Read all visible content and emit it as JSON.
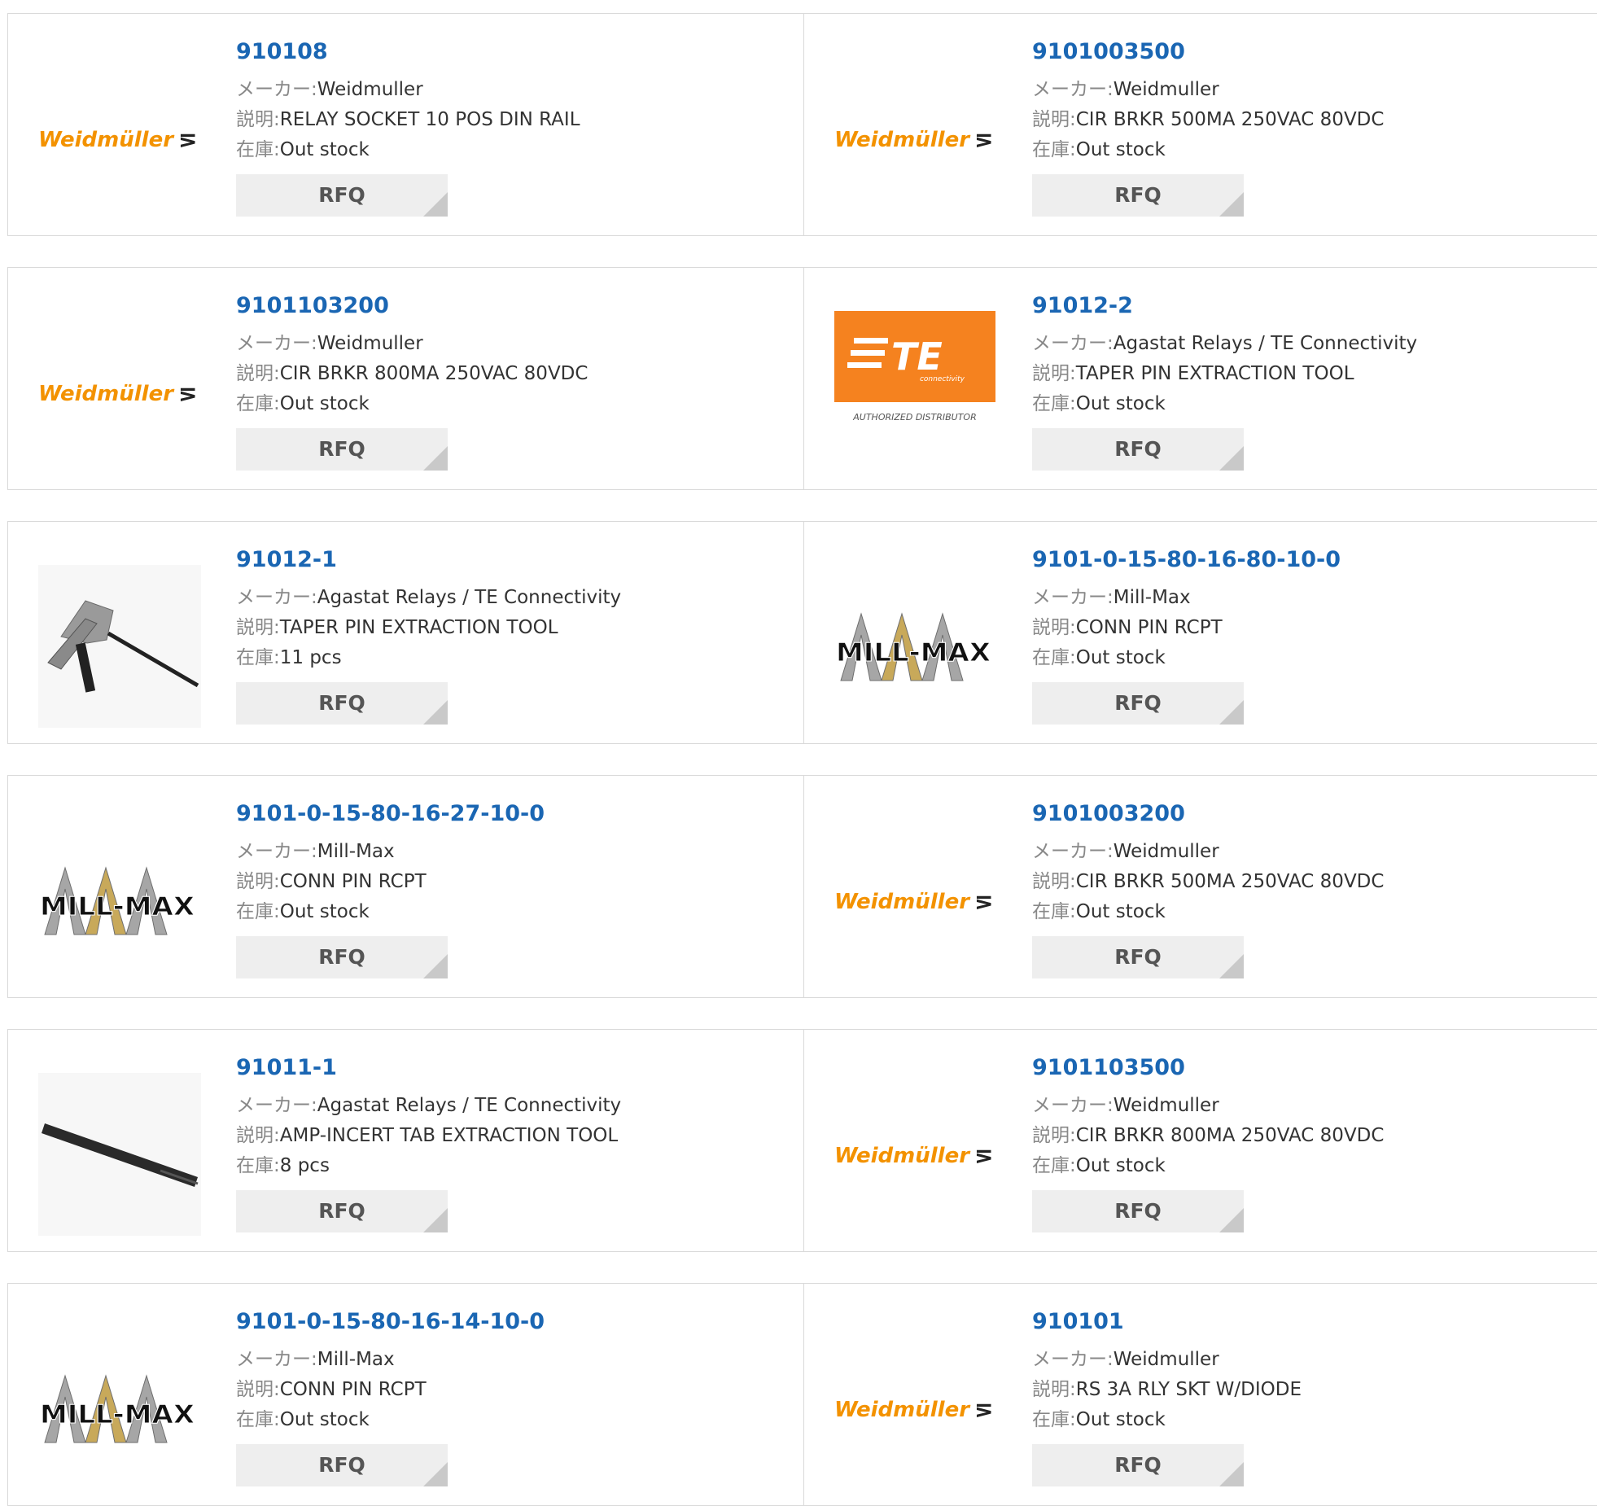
{
  "labels": {
    "maker": "メーカー:",
    "description": "説明:",
    "stock": "在庫:",
    "rfq": "RFQ"
  },
  "logos": {
    "weidmuller": {
      "text": "Weidmüller",
      "symbol": "⋝",
      "color": "#f39200"
    },
    "te": {
      "text": "TE",
      "subtext": "connectivity",
      "caption": "AUTHORIZED DISTRIBUTOR",
      "bg": "#f5821f"
    },
    "millmax": {
      "text": "MILL-MAX"
    }
  },
  "colors": {
    "part_link": "#1a66b3",
    "border": "#d9d9d9",
    "button_bg": "#eeeeee"
  },
  "rows": [
    {
      "left": {
        "part": "910108",
        "maker": "Weidmuller",
        "desc": "RELAY SOCKET 10 POS DIN RAIL",
        "stock": "Out stock",
        "logo": "weidmuller"
      },
      "right": {
        "part": "9101003500",
        "maker": "Weidmuller",
        "desc": "CIR BRKR 500MA 250VAC 80VDC",
        "stock": "Out stock",
        "logo": "weidmuller"
      }
    },
    {
      "left": {
        "part": "9101103200",
        "maker": "Weidmuller",
        "desc": "CIR BRKR 800MA 250VAC 80VDC",
        "stock": "Out stock",
        "logo": "weidmuller"
      },
      "right": {
        "part": "91012-2",
        "maker": "Agastat Relays / TE Connectivity",
        "desc": "TAPER PIN EXTRACTION TOOL",
        "stock": "Out stock",
        "logo": "te"
      }
    },
    {
      "left": {
        "part": "91012-1",
        "maker": "Agastat Relays / TE Connectivity",
        "desc": "TAPER PIN EXTRACTION TOOL",
        "stock": "11 pcs",
        "logo": "tool-gun"
      },
      "right": {
        "part": "9101-0-15-80-16-80-10-0",
        "maker": "Mill-Max",
        "desc": "CONN PIN RCPT",
        "stock": "Out stock",
        "logo": "millmax"
      }
    },
    {
      "left": {
        "part": "9101-0-15-80-16-27-10-0",
        "maker": "Mill-Max",
        "desc": "CONN PIN RCPT",
        "stock": "Out stock",
        "logo": "millmax"
      },
      "right": {
        "part": "9101003200",
        "maker": "Weidmuller",
        "desc": "CIR BRKR 500MA 250VAC 80VDC",
        "stock": "Out stock",
        "logo": "weidmuller"
      }
    },
    {
      "left": {
        "part": "91011-1",
        "maker": "Agastat Relays / TE Connectivity",
        "desc": "AMP-INCERT TAB EXTRACTION TOOL",
        "stock": "8 pcs",
        "logo": "tool-bar"
      },
      "right": {
        "part": "9101103500",
        "maker": "Weidmuller",
        "desc": "CIR BRKR 800MA 250VAC 80VDC",
        "stock": "Out stock",
        "logo": "weidmuller"
      }
    },
    {
      "left": {
        "part": "9101-0-15-80-16-14-10-0",
        "maker": "Mill-Max",
        "desc": "CONN PIN RCPT",
        "stock": "Out stock",
        "logo": "millmax"
      },
      "right": {
        "part": "910101",
        "maker": "Weidmuller",
        "desc": "RS 3A RLY SKT W/DIODE",
        "stock": "Out stock",
        "logo": "weidmuller"
      }
    }
  ]
}
